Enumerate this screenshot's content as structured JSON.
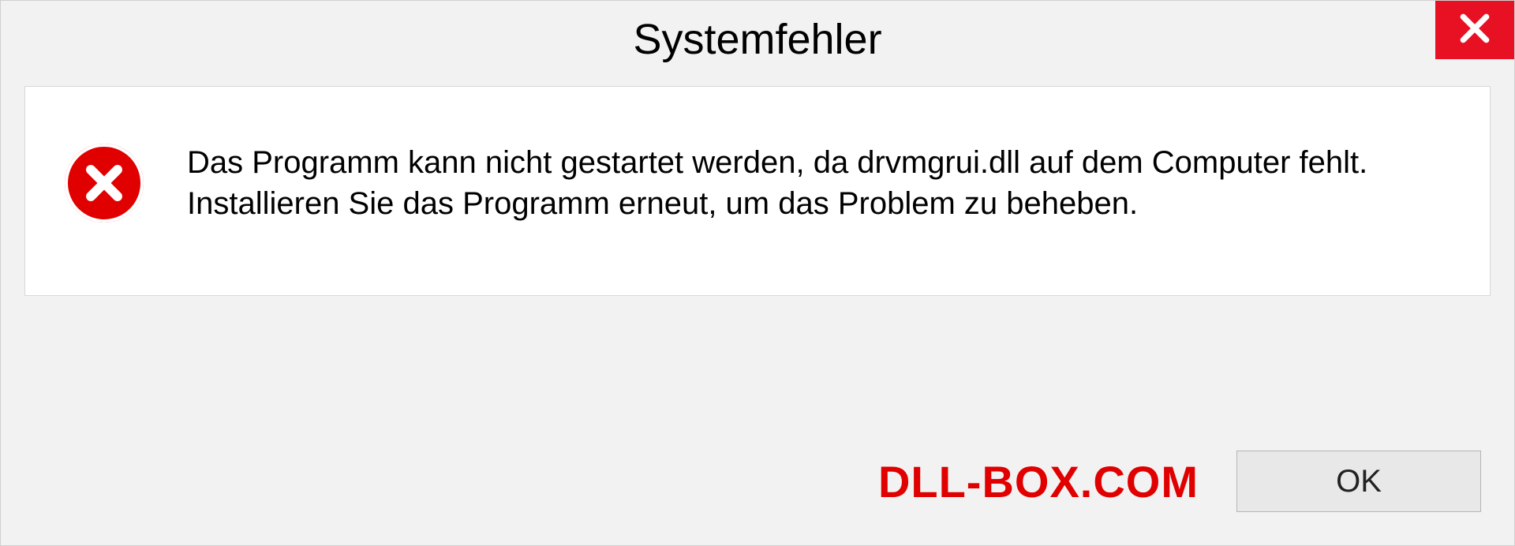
{
  "title": "Systemfehler",
  "message": "Das Programm kann nicht gestartet werden, da drvmgrui.dll auf dem Computer fehlt. Installieren Sie das Programm erneut, um das Problem zu beheben.",
  "watermark": "DLL-BOX.COM",
  "ok_label": "OK"
}
